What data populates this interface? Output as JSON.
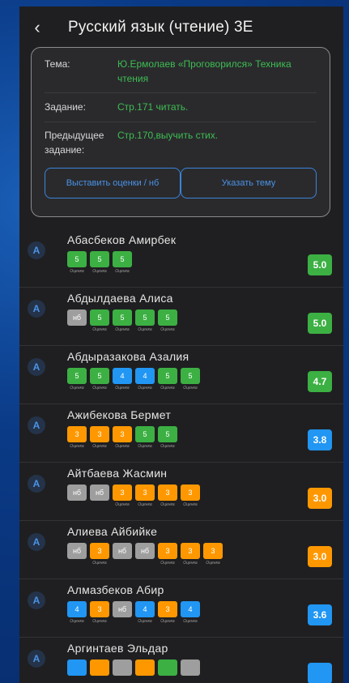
{
  "header": {
    "back_icon": "‹",
    "title": "Русский язык (чтение) 3Е"
  },
  "lesson": {
    "topic_label": "Тема:",
    "topic_value": "Ю.Ермолаев «Проговорился» Техника чтения",
    "task_label": "Задание:",
    "task_value": "Стр.171 читать.",
    "prev_label": "Предыдущее задание:",
    "prev_value": "Стр.170,выучить стих.",
    "grades_button": "Выставить оценки / нб",
    "topic_button": "Указать тему"
  },
  "colors": {
    "green": "#3cb043",
    "blue": "#2196f3",
    "orange": "#ff9800",
    "gray": "#9e9e9e"
  },
  "students": [
    {
      "initial": "А",
      "name": "Абасбеков Амирбек",
      "avg": "5.0",
      "avg_color": "green",
      "grades": [
        {
          "v": "5",
          "c": "green",
          "l": "Оценка"
        },
        {
          "v": "5",
          "c": "green",
          "l": "Оценка"
        },
        {
          "v": "5",
          "c": "green",
          "l": "Оценка"
        }
      ]
    },
    {
      "initial": "А",
      "name": "Абдылдаева Алиса",
      "avg": "5.0",
      "avg_color": "green",
      "grades": [
        {
          "v": "нб",
          "c": "gray",
          "l": ""
        },
        {
          "v": "5",
          "c": "green",
          "l": "Оценка"
        },
        {
          "v": "5",
          "c": "green",
          "l": "Оценка"
        },
        {
          "v": "5",
          "c": "green",
          "l": "Оценка"
        },
        {
          "v": "5",
          "c": "green",
          "l": "Оценка"
        }
      ]
    },
    {
      "initial": "А",
      "name": "Абдыразакова Азалия",
      "avg": "4.7",
      "avg_color": "green",
      "grades": [
        {
          "v": "5",
          "c": "green",
          "l": "Оценка"
        },
        {
          "v": "5",
          "c": "green",
          "l": "Оценка"
        },
        {
          "v": "4",
          "c": "blue",
          "l": "Оценка"
        },
        {
          "v": "4",
          "c": "blue",
          "l": "Оценка"
        },
        {
          "v": "5",
          "c": "green",
          "l": "Оценка"
        },
        {
          "v": "5",
          "c": "green",
          "l": "Оценка"
        }
      ]
    },
    {
      "initial": "А",
      "name": "Ажибекова Бермет",
      "avg": "3.8",
      "avg_color": "blue",
      "grades": [
        {
          "v": "3",
          "c": "orange",
          "l": "Оценка"
        },
        {
          "v": "3",
          "c": "orange",
          "l": "Оценка"
        },
        {
          "v": "3",
          "c": "orange",
          "l": "Оценка"
        },
        {
          "v": "5",
          "c": "green",
          "l": "Оценка"
        },
        {
          "v": "5",
          "c": "green",
          "l": "Оценка"
        }
      ]
    },
    {
      "initial": "А",
      "name": "Айтбаева Жасмин",
      "avg": "3.0",
      "avg_color": "orange",
      "grades": [
        {
          "v": "нб",
          "c": "gray",
          "l": ""
        },
        {
          "v": "нб",
          "c": "gray",
          "l": ""
        },
        {
          "v": "3",
          "c": "orange",
          "l": "Оценка"
        },
        {
          "v": "3",
          "c": "orange",
          "l": "Оценка"
        },
        {
          "v": "3",
          "c": "orange",
          "l": "Оценка"
        },
        {
          "v": "3",
          "c": "orange",
          "l": "Оценка"
        }
      ]
    },
    {
      "initial": "А",
      "name": "Алиева Айбийке",
      "avg": "3.0",
      "avg_color": "orange",
      "grades": [
        {
          "v": "нб",
          "c": "gray",
          "l": ""
        },
        {
          "v": "3",
          "c": "orange",
          "l": "Оценка"
        },
        {
          "v": "нб",
          "c": "gray",
          "l": ""
        },
        {
          "v": "нб",
          "c": "gray",
          "l": ""
        },
        {
          "v": "3",
          "c": "orange",
          "l": "Оценка"
        },
        {
          "v": "3",
          "c": "orange",
          "l": "Оценка"
        },
        {
          "v": "3",
          "c": "orange",
          "l": "Оценка"
        }
      ]
    },
    {
      "initial": "А",
      "name": "Алмазбеков Абир",
      "avg": "3.6",
      "avg_color": "blue",
      "grades": [
        {
          "v": "4",
          "c": "blue",
          "l": "Оценка"
        },
        {
          "v": "3",
          "c": "orange",
          "l": "Оценка"
        },
        {
          "v": "нб",
          "c": "gray",
          "l": ""
        },
        {
          "v": "4",
          "c": "blue",
          "l": "Оценка"
        },
        {
          "v": "3",
          "c": "orange",
          "l": "Оценка"
        },
        {
          "v": "4",
          "c": "blue",
          "l": "Оценка"
        }
      ]
    },
    {
      "initial": "А",
      "name": "Аргинтаев Эльдар",
      "avg": "",
      "avg_color": "blue",
      "grades": [
        {
          "v": "",
          "c": "blue",
          "l": ""
        },
        {
          "v": "",
          "c": "orange",
          "l": ""
        },
        {
          "v": "",
          "c": "gray",
          "l": ""
        },
        {
          "v": "",
          "c": "orange",
          "l": ""
        },
        {
          "v": "",
          "c": "green",
          "l": ""
        },
        {
          "v": "",
          "c": "gray",
          "l": ""
        }
      ]
    }
  ]
}
